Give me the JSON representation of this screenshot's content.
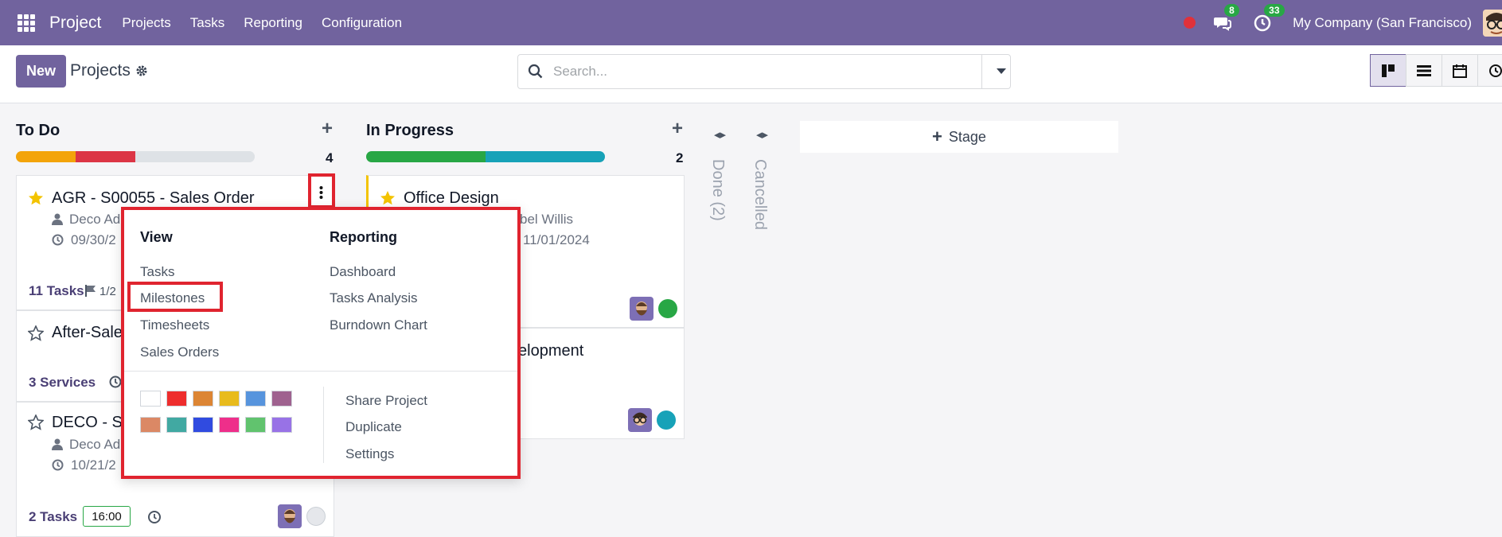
{
  "navbar": {
    "brand": "Project",
    "menu": [
      "Projects",
      "Tasks",
      "Reporting",
      "Configuration"
    ],
    "messages_badge": "8",
    "activities_badge": "33",
    "company": "My Company (San Francisco)"
  },
  "control": {
    "new_label": "New",
    "breadcrumb": "Projects",
    "search_placeholder": "Search..."
  },
  "columns": [
    {
      "title": "To Do",
      "count": "4"
    },
    {
      "title": "In Progress",
      "count": "2"
    }
  ],
  "folded_columns": [
    "Done (2)",
    "Cancelled"
  ],
  "stage_label": "Stage",
  "cards": {
    "agr_title": "AGR - S00055 - Sales Order",
    "agr_customer": "Deco Ad",
    "agr_date": "09/30/2",
    "agr_tasks": "11 Tasks",
    "agr_milestones": "1/2",
    "after_title": "After-Sale",
    "after_services": "3 Services",
    "deco_title": "DECO - S",
    "deco_customer": "Deco Ad",
    "deco_date": "10/21/2",
    "deco_tasks": "2 Tasks",
    "deco_time": "16:00",
    "office_title": "Office Design",
    "office_customer": "bel Willis",
    "office_date": "11/01/2024",
    "dev_title": "elopment"
  },
  "dropdown": {
    "view_heading": "View",
    "reporting_heading": "Reporting",
    "view_items": [
      "Tasks",
      "Milestones",
      "Timesheets",
      "Sales Orders"
    ],
    "reporting_items": [
      "Dashboard",
      "Tasks Analysis",
      "Burndown Chart"
    ],
    "action_items": [
      "Share Project",
      "Duplicate",
      "Settings"
    ],
    "colors": [
      "#ffffff",
      "#ee2d2d",
      "#dc8534",
      "#e8bb1d",
      "#5794dd",
      "#9f628f",
      "#db8865",
      "#41a9a2",
      "#304be0",
      "#ee2f8a",
      "#61c36e",
      "#9872e6"
    ]
  },
  "colors": {
    "brand": "#71639e",
    "progress_todo": [
      "#f3a40a",
      "#dc3545",
      "#dee2e6"
    ],
    "progress_inprogress": [
      "#28a745",
      "#17a2b8"
    ]
  }
}
